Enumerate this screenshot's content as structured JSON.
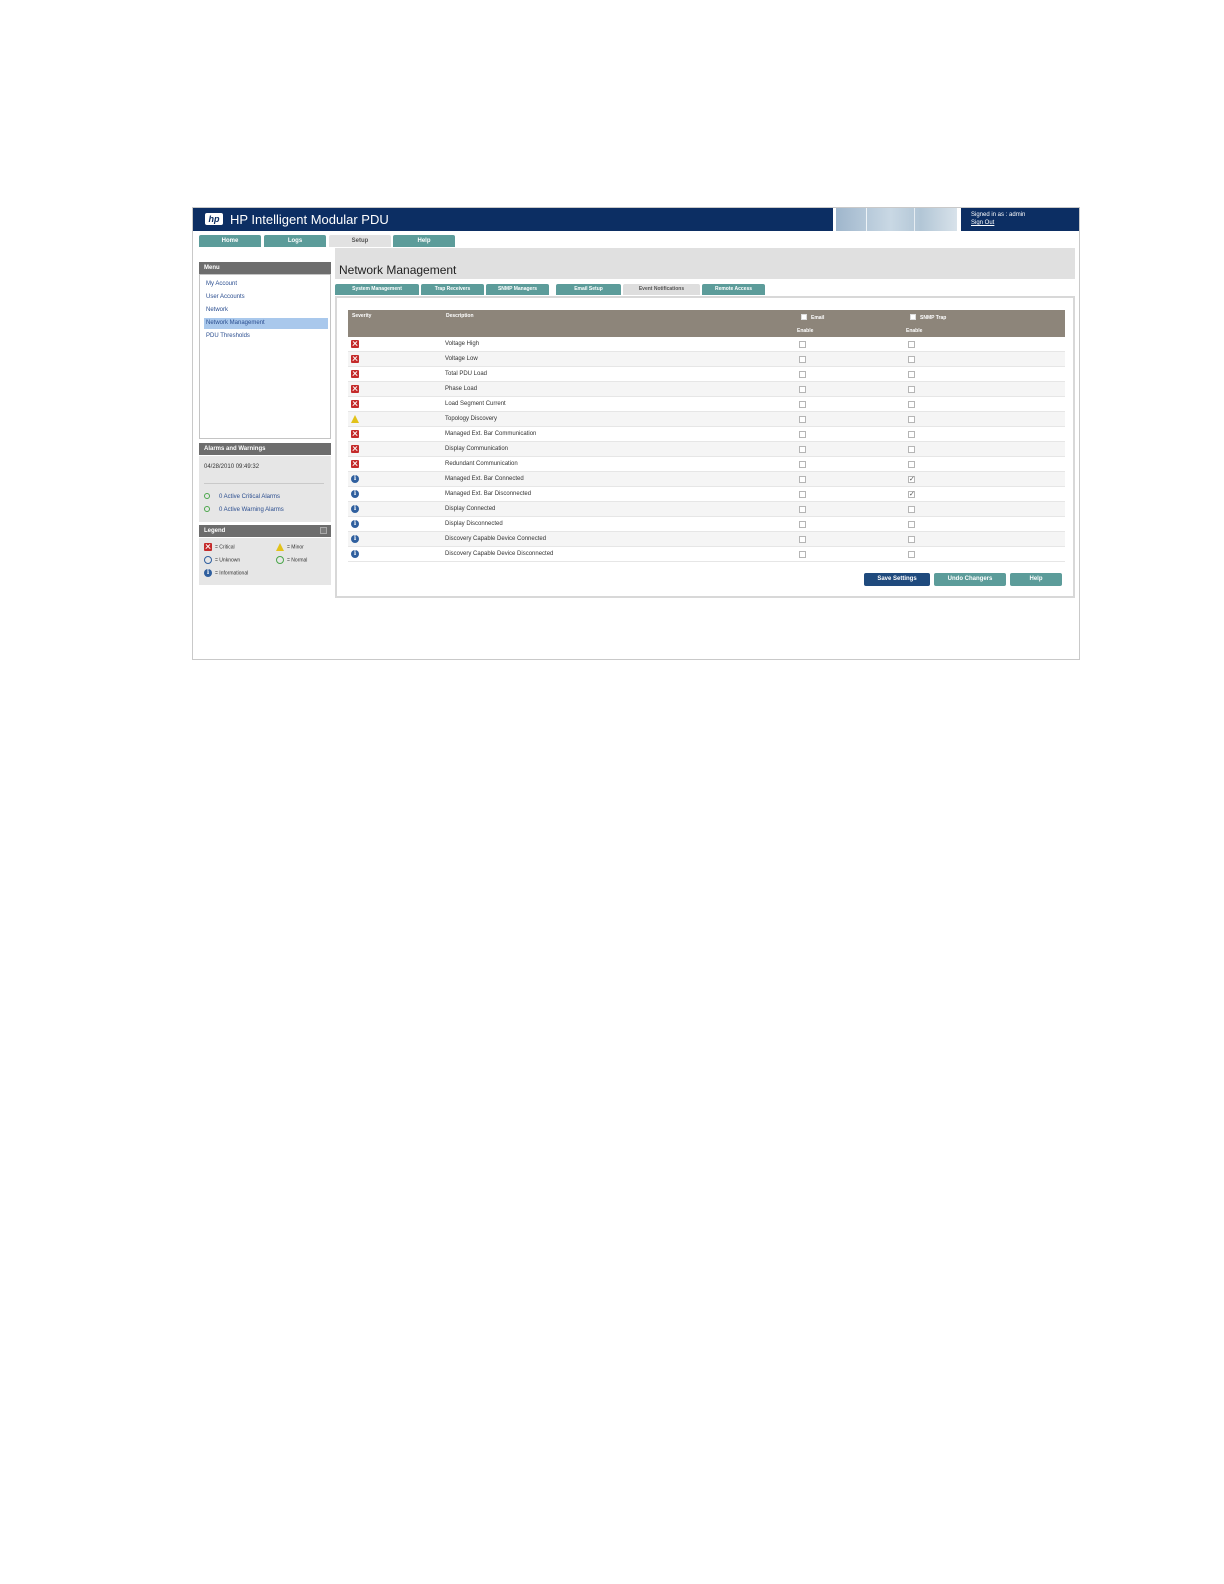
{
  "app": {
    "title": "HP Intelligent Modular PDU",
    "logo_text": "hp",
    "signed_in": "Signed in as : admin",
    "sign_out": "Sign Out"
  },
  "top_tabs": [
    {
      "label": "Home",
      "active": false
    },
    {
      "label": "Logs",
      "active": false
    },
    {
      "label": "Setup",
      "active": true
    },
    {
      "label": "Help",
      "active": false
    }
  ],
  "menu": {
    "header": "Menu",
    "items": [
      {
        "label": "My Account",
        "selected": false
      },
      {
        "label": "User Accounts",
        "selected": false
      },
      {
        "label": "Network",
        "selected": false
      },
      {
        "label": "Network Management",
        "selected": true
      },
      {
        "label": "PDU Thresholds",
        "selected": false
      }
    ]
  },
  "alarms": {
    "header": "Alarms and Warnings",
    "timestamp": "04/28/2010 09:49:32",
    "critical": "0 Active Critical Alarms",
    "warning": "0 Active Warning Alarms"
  },
  "legend": {
    "header": "Legend",
    "items": [
      {
        "icon": "critical-icon",
        "label": "= Critical"
      },
      {
        "icon": "minor-icon",
        "label": "= Minor"
      },
      {
        "icon": "unknown-icon",
        "label": "= Unknown"
      },
      {
        "icon": "normal-icon",
        "label": "= Normal"
      },
      {
        "icon": "informational-icon",
        "label": "= Informational"
      }
    ]
  },
  "page": {
    "title": "Network Management"
  },
  "sub_tabs": [
    {
      "label": "System Management",
      "active": false
    },
    {
      "label": "Trap Receivers",
      "active": false
    },
    {
      "label": "SNMP Managers",
      "active": false
    },
    {
      "label": "Email Setup",
      "active": false
    },
    {
      "label": "Event Notifications",
      "active": true
    },
    {
      "label": "Remote Access",
      "active": false
    }
  ],
  "table": {
    "severity_header": "Severity",
    "description_header": "Description",
    "email_header": "Email",
    "email_sub": "Enable",
    "snmp_header": "SNMP Trap",
    "snmp_sub": "Enable",
    "rows": [
      {
        "severity": "critical",
        "description": "Voltage High",
        "email": false,
        "snmp": false
      },
      {
        "severity": "critical",
        "description": "Voltage Low",
        "email": false,
        "snmp": false
      },
      {
        "severity": "critical",
        "description": "Total PDU Load",
        "email": false,
        "snmp": false
      },
      {
        "severity": "critical",
        "description": "Phase Load",
        "email": false,
        "snmp": false
      },
      {
        "severity": "critical",
        "description": "Load Segment Current",
        "email": false,
        "snmp": false
      },
      {
        "severity": "minor",
        "description": "Topology Discovery",
        "email": false,
        "snmp": false
      },
      {
        "severity": "critical",
        "description": "Managed Ext. Bar Communication",
        "email": false,
        "snmp": false
      },
      {
        "severity": "critical",
        "description": "Display Communication",
        "email": false,
        "snmp": false
      },
      {
        "severity": "critical",
        "description": "Redundant Communication",
        "email": false,
        "snmp": false
      },
      {
        "severity": "info",
        "description": "Managed Ext. Bar Connected",
        "email": false,
        "snmp": true
      },
      {
        "severity": "info",
        "description": "Managed Ext. Bar Disconnected",
        "email": false,
        "snmp": true
      },
      {
        "severity": "info",
        "description": "Display Connected",
        "email": false,
        "snmp": false
      },
      {
        "severity": "info",
        "description": "Display Disconnected",
        "email": false,
        "snmp": false
      },
      {
        "severity": "info",
        "description": "Discovery Capable Device Connected",
        "email": false,
        "snmp": false
      },
      {
        "severity": "info",
        "description": "Discovery Capable Device Disconnected",
        "email": false,
        "snmp": false
      }
    ]
  },
  "buttons": {
    "save": "Save Settings",
    "undo": "Undo Changers",
    "help": "Help"
  },
  "colors": {
    "header_navy": "#0c2e63",
    "tab_teal": "#5c9c9a",
    "critical": "#c42b2b",
    "informational": "#2f5f9e",
    "minor": "#e2c21a",
    "normal": "#4aa64a"
  }
}
